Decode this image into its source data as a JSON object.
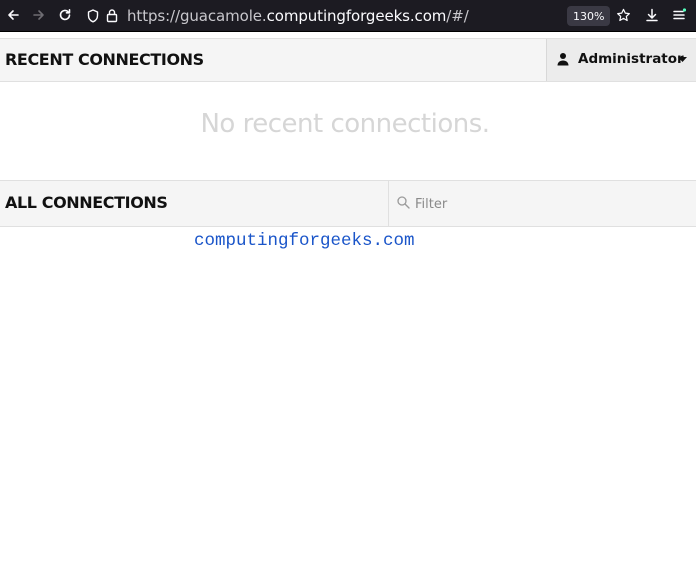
{
  "browser": {
    "url_prefix": "https://guacamole.",
    "url_host": "computingforgeeks.com",
    "url_suffix": "/#/",
    "zoom_level": "130%",
    "icons": [
      "back-arrow-icon",
      "forward-arrow-icon",
      "reload-icon",
      "shield-icon",
      "lock-icon",
      "star-icon",
      "download-icon",
      "menu-icon"
    ]
  },
  "recent": {
    "title": "RECENT CONNECTIONS",
    "empty_message": "No recent connections."
  },
  "user_menu": {
    "name": "Administrator"
  },
  "all": {
    "title": "ALL CONNECTIONS",
    "filter_placeholder": "Filter",
    "connections": [
      "computingforgeeks.com"
    ]
  },
  "colors": {
    "toolbar_bg": "#1c1b22",
    "link": "#1a55c9",
    "empty_text": "#d6d6d6",
    "header_bg": "#f5f5f5"
  }
}
